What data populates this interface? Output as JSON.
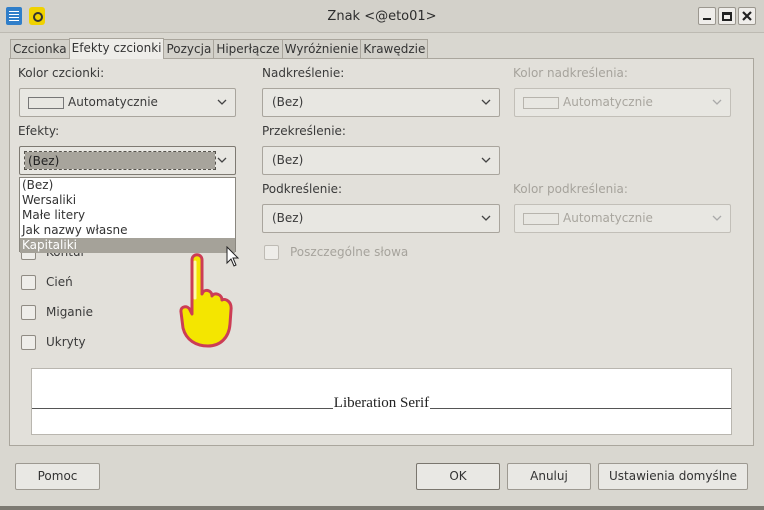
{
  "window": {
    "title": "Znak <@eto01>",
    "buttons": {
      "minimize": "_",
      "maximize": "□",
      "close": "✕"
    }
  },
  "tabs": [
    {
      "label": "Czcionka"
    },
    {
      "label": "Efekty czcionki"
    },
    {
      "label": "Pozycja"
    },
    {
      "label": "Hiperłącze"
    },
    {
      "label": "Wyróżnienie"
    },
    {
      "label": "Krawędzie"
    }
  ],
  "font_color": {
    "label": "Kolor czcionki:",
    "value": "Automatycznie"
  },
  "effects": {
    "label": "Efekty:",
    "value": "(Bez)",
    "options": [
      "(Bez)",
      "Wersaliki",
      "Małe litery",
      "Jak nazwy własne",
      "Kapitaliki"
    ],
    "highlighted_index": 4
  },
  "checkboxes": {
    "outline": "Kontur",
    "shadow": "Cień",
    "blink": "Miganie",
    "hidden": "Ukryty"
  },
  "overline": {
    "label": "Nadkreślenie:",
    "value": "(Bez)"
  },
  "overline_color": {
    "label": "Kolor nadkreślenia:",
    "value": "Automatycznie"
  },
  "strikethrough": {
    "label": "Przekreślenie:",
    "value": "(Bez)"
  },
  "underline": {
    "label": "Podkreślenie:",
    "value": "(Bez)"
  },
  "underline_color": {
    "label": "Kolor podkreślenia:",
    "value": "Automatycznie"
  },
  "individual_words": {
    "label": "Poszczególne słowa"
  },
  "preview": {
    "text": "Liberation Serif"
  },
  "footer": {
    "help": "Pomoc",
    "ok": "OK",
    "cancel": "Anuluj",
    "reset": "Ustawienia domyślne"
  },
  "colors": {
    "highlight": "#a5a299",
    "pointer": "#f4e600"
  }
}
